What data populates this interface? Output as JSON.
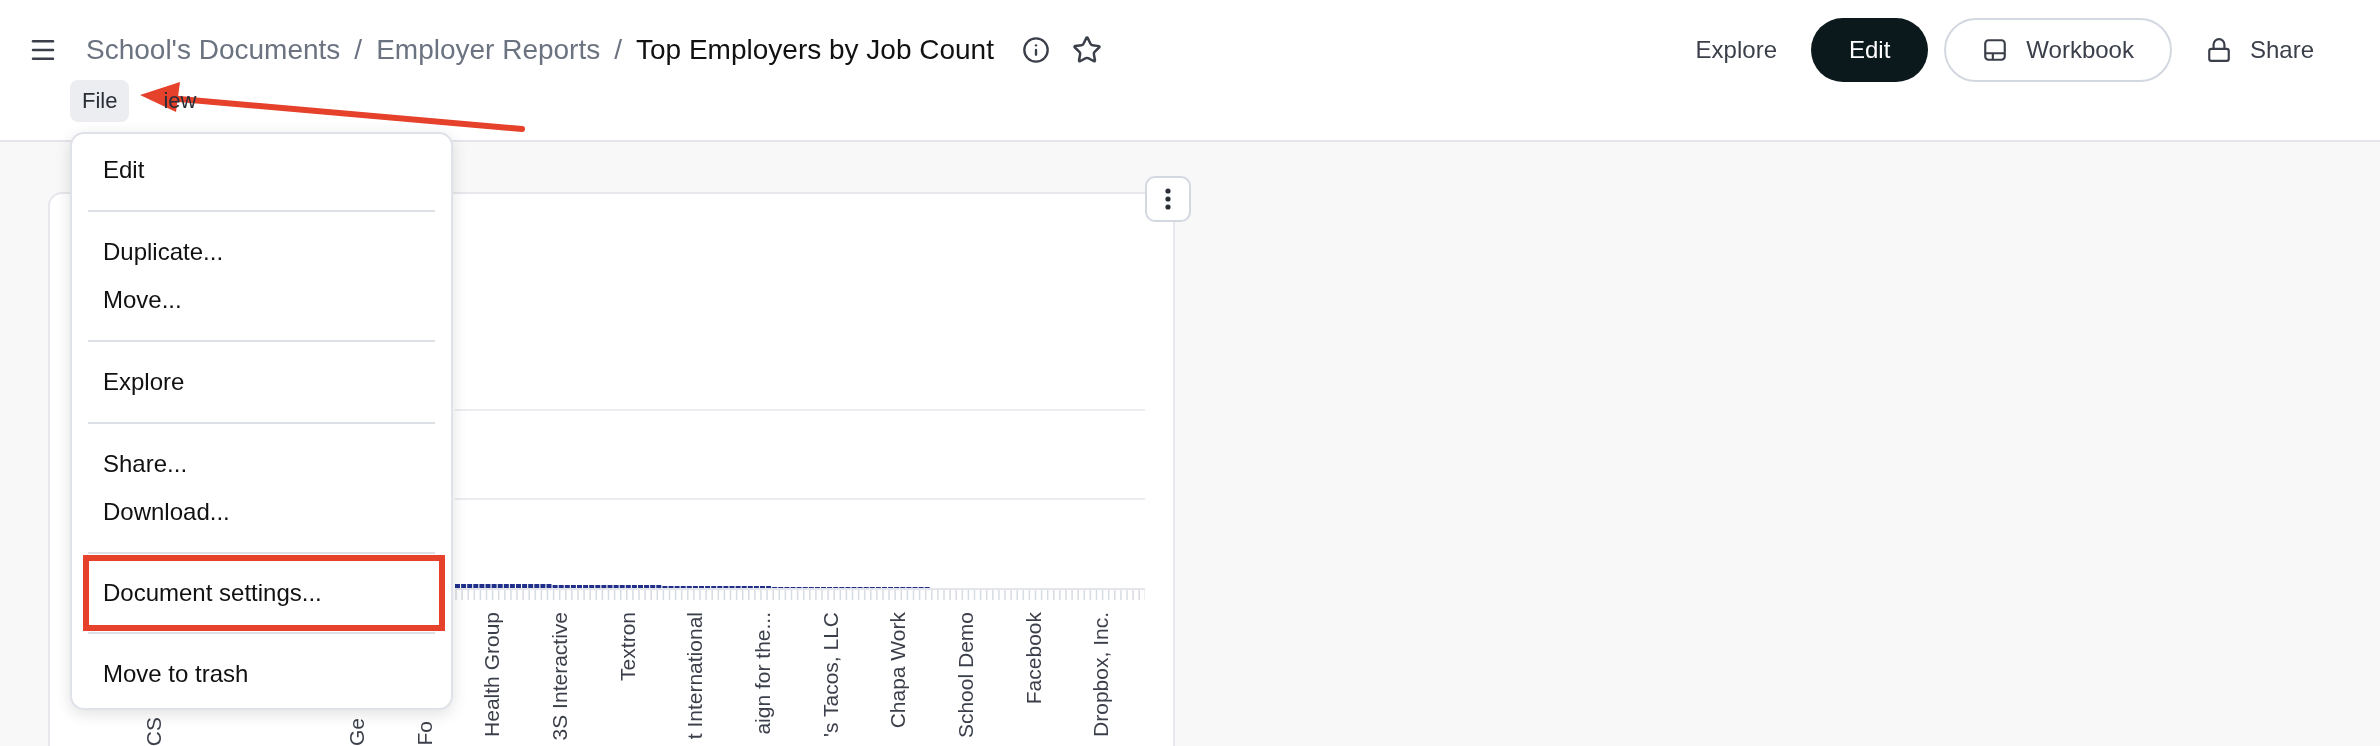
{
  "header": {
    "breadcrumb": [
      {
        "label": "School's Documents",
        "separator": "/"
      },
      {
        "label": "Employer Reports",
        "separator": "/"
      }
    ],
    "title": "Top Employers by Job Count"
  },
  "menu_bar": [
    {
      "label": "File",
      "selected": true
    },
    {
      "label": "iew",
      "selected": false
    }
  ],
  "actions": [
    {
      "label": "Explore",
      "kind": "text"
    },
    {
      "label": "Edit",
      "kind": "primary"
    },
    {
      "label": "Workbook",
      "kind": "outline"
    },
    {
      "label": "Share",
      "kind": "lock"
    }
  ],
  "file_menu": {
    "groups": [
      [
        {
          "label": "Edit",
          "annotated": false
        }
      ],
      [
        {
          "label": "Duplicate...",
          "annotated": false
        },
        {
          "label": "Move...",
          "annotated": false
        }
      ],
      [
        {
          "label": "Explore",
          "annotated": false
        }
      ],
      [
        {
          "label": "Share...",
          "annotated": false
        },
        {
          "label": "Download...",
          "annotated": false
        }
      ],
      [
        {
          "label": "Document settings...",
          "annotated": true
        }
      ],
      [
        {
          "label": "Move to trash",
          "annotated": false
        }
      ]
    ]
  },
  "chart": {
    "x_labels": [
      "CS",
      "Ge",
      "Fo",
      "Health Group",
      "3S Interactive",
      "Textron",
      "t International",
      "aign for the...",
      "'s Tacos, LLC",
      "Chapa Work",
      "School Demo",
      "Facebook",
      "Dropbox, Inc."
    ]
  }
}
